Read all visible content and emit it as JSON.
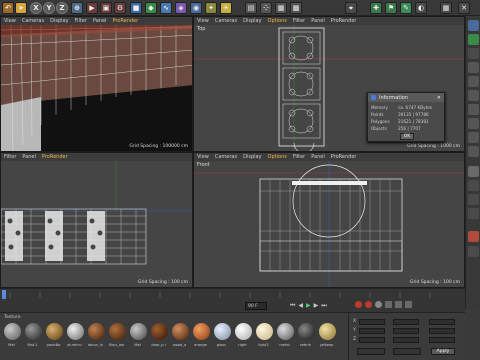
{
  "toolbar": {
    "x": "X",
    "y": "Y",
    "z": "Z"
  },
  "viewports": {
    "perspective": {
      "menu": [
        "View",
        "Cameras",
        "Display",
        "Filter",
        "Panel",
        "ProRender"
      ],
      "selected": "ProRender",
      "grid": "Grid Spacing : 100000 cm"
    },
    "top": {
      "menu": [
        "View",
        "Cameras",
        "Display",
        "Options",
        "Filter",
        "Panel",
        "ProRender"
      ],
      "selected": "Options",
      "label": "Top",
      "grid": "Grid Spacing : 1000 cm"
    },
    "right": {
      "menu": [
        "Filter",
        "Panel",
        "ProRender"
      ],
      "selected": "ProRender",
      "grid": "Grid Spacing : 100 cm"
    },
    "front": {
      "menu": [
        "View",
        "Cameras",
        "Display",
        "Options",
        "Filter",
        "Panel",
        "ProRender"
      ],
      "selected": "Options",
      "label": "Front",
      "grid": "Grid Spacing : 100 cm"
    }
  },
  "info_dialog": {
    "title": "Information",
    "ok": "OK",
    "rows": [
      {
        "label": "Memory",
        "value": "ca. 6747 KBytes"
      },
      {
        "label": "Points",
        "value": "39135 | 97786"
      },
      {
        "label": "Polygons",
        "value": "21621 | 78381"
      },
      {
        "label": "Objects",
        "value": "256 | 7707"
      }
    ]
  },
  "timeline": {
    "frame_field": "90 F"
  },
  "materials": {
    "header": "Texture",
    "items": [
      "Mat",
      "Mat.1",
      "paneBo",
      "aluminu",
      "decor_in",
      "floor_wo",
      "Mat",
      "door_p.i",
      "wood_a",
      "orange",
      "glass",
      "right",
      "light2",
      "metal",
      "zebrin",
      "yellowp"
    ]
  },
  "coords": {
    "rows": [
      "X",
      "Y",
      "Z"
    ],
    "apply": "Apply"
  },
  "colors": {
    "accent": "#f0b74a",
    "bg": "#3a3a3a"
  }
}
